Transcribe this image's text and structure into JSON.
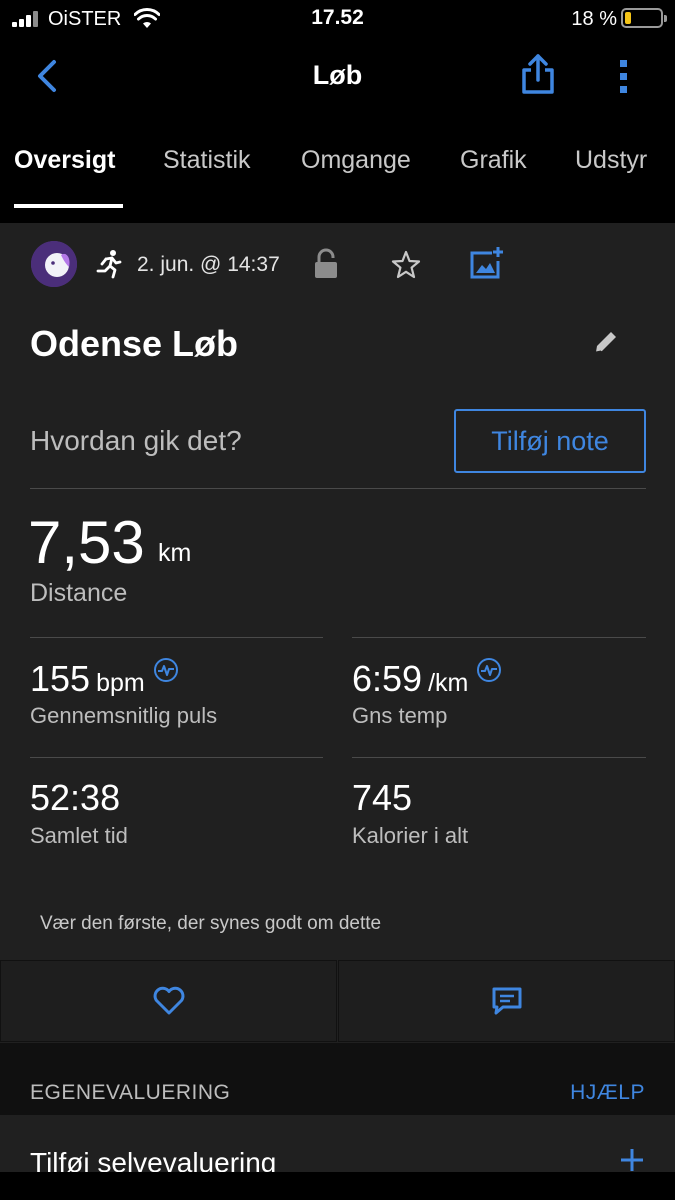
{
  "status_bar": {
    "carrier": "OiSTER",
    "time": "17.52",
    "battery_pct": "18 %",
    "battery_level": 0.18
  },
  "nav": {
    "title": "Løb"
  },
  "tabs": [
    {
      "label": "Oversigt",
      "active": true
    },
    {
      "label": "Statistik",
      "active": false
    },
    {
      "label": "Omgange",
      "active": false
    },
    {
      "label": "Grafik",
      "active": false
    },
    {
      "label": "Udstyr",
      "active": false
    }
  ],
  "activity": {
    "date": "2. jun. @ 14:37",
    "title": "Odense Løb",
    "note_prompt": "Hvordan gik det?",
    "note_button": "Tilføj note"
  },
  "distance": {
    "value": "7,53",
    "unit": "km",
    "label": "Distance"
  },
  "stats": {
    "heart_rate": {
      "value": "155",
      "unit": "bpm",
      "label": "Gennemsnitlig puls"
    },
    "pace": {
      "value": "6:59",
      "unit": "/km",
      "label": "Gns temp"
    },
    "total_time": {
      "value": "52:38",
      "label": "Samlet tid"
    },
    "calories": {
      "value": "745",
      "label": "Kalorier i alt"
    }
  },
  "social": {
    "likes_text": "Vær den første, der synes godt om dette"
  },
  "self_eval": {
    "section_title": "EGENEVALUERING",
    "help_label": "HJÆLP",
    "add_label": "Tilføj selvevaluering"
  },
  "colors": {
    "accent": "#3f86e0",
    "card_bg": "#202020",
    "battery": "#f5c518"
  }
}
